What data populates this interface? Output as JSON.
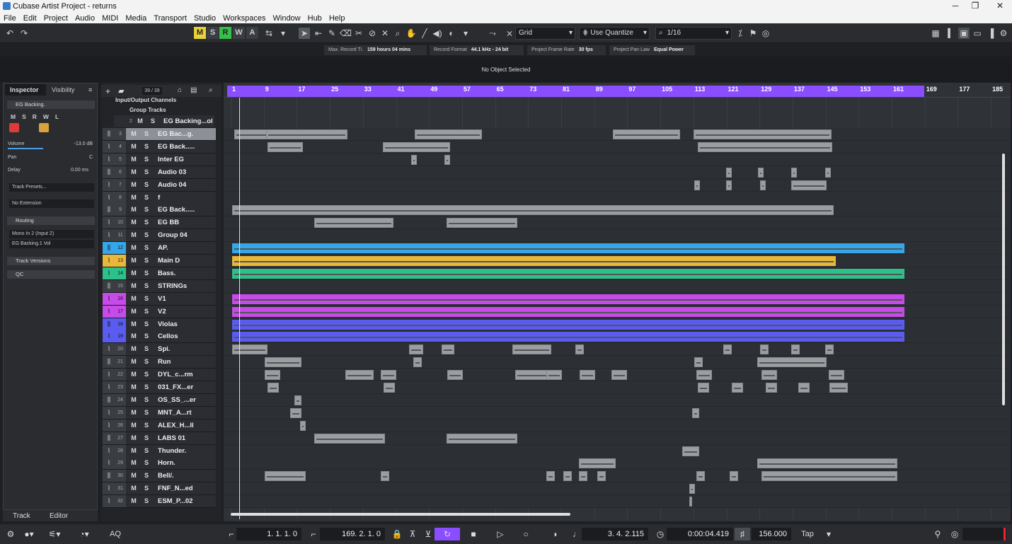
{
  "window": {
    "title": "Cubase Artist Project - returns",
    "min": "─",
    "max": "❐",
    "close": "✕"
  },
  "menu": [
    "File",
    "Edit",
    "Project",
    "Audio",
    "MIDI",
    "Media",
    "Transport",
    "Studio",
    "Workspaces",
    "Window",
    "Hub",
    "Help"
  ],
  "toolbar": {
    "undo": "↶",
    "redo": "↷",
    "m": "M",
    "s": "S",
    "r": "R",
    "w": "W",
    "a": "A",
    "grid_label": "Grid",
    "quantize_label": "Use Quantize",
    "quantize_value": "1/16"
  },
  "info": {
    "max_record_label": "Max. Record Ti.",
    "max_record_value": "159 hours 04 mins",
    "format_label": "Record Format",
    "format_value": "44.1 kHz - 24 bit",
    "frame_label": "Project Frame Rate",
    "frame_value": "30 fps",
    "pan_label": "Project Pan Law",
    "pan_value": "Equal Power"
  },
  "status": "No Object Selected",
  "inspector": {
    "tab1": "Inspector",
    "tab2": "Visibility",
    "track_name": "EG Backing.",
    "volume_label": "Volume",
    "volume_value": "-13.0 dB",
    "pan_label": "Pan",
    "pan_value": "C",
    "delay_label": "Delay",
    "delay_value": "0.00 ms",
    "presets": "Track Presets...",
    "extension": "No Extension",
    "routing": "Routing",
    "input": "Mono In 2 (Input 2)",
    "output": "EG Backing.1 Vol",
    "versions": "Track Versions",
    "qc": "QC",
    "tab_track": "Track",
    "tab_editor": "Editor",
    "btn_m": "M",
    "btn_s": "S",
    "btn_r": "R",
    "btn_w": "W",
    "btn_l": "L"
  },
  "tracklist": {
    "count": "39 / 39",
    "folders": [
      {
        "name": "Input/Output Channels"
      },
      {
        "name": "Group Tracks"
      }
    ],
    "group_row": {
      "num": "2",
      "name": "EG Backing...ol"
    },
    "m": "M",
    "s": "S",
    "tracks": [
      {
        "num": "3",
        "name": "EG Bac...g.",
        "color": "#9b9ea3"
      },
      {
        "num": "4",
        "name": "EG Back.....",
        "color": "#9b9ea3"
      },
      {
        "num": "5",
        "name": "Inter EG",
        "color": "#9b9ea3"
      },
      {
        "num": "6",
        "name": "Audio 03",
        "color": "#9b9ea3"
      },
      {
        "num": "7",
        "name": "Audio 04",
        "color": "#9b9ea3"
      },
      {
        "num": "8",
        "name": "f",
        "color": "#9b9ea3"
      },
      {
        "num": "9",
        "name": "EG Back.....",
        "color": "#9b9ea3"
      },
      {
        "num": "10",
        "name": "EG BB",
        "color": "#9b9ea3"
      },
      {
        "num": "11",
        "name": "Group 04",
        "color": "#9b9ea3"
      },
      {
        "num": "12",
        "name": "AP.",
        "color": "#35a6e8"
      },
      {
        "num": "13",
        "name": "Main D",
        "color": "#e8b83a"
      },
      {
        "num": "14",
        "name": "Bass.",
        "color": "#2cc08a"
      },
      {
        "num": "15",
        "name": "STRINGs",
        "color": "#9b9ea3"
      },
      {
        "num": "16",
        "name": "V1",
        "color": "#c64be8"
      },
      {
        "num": "17",
        "name": "V2",
        "color": "#c64be8"
      },
      {
        "num": "18",
        "name": "Violas",
        "color": "#5a5cf0"
      },
      {
        "num": "19",
        "name": "Cellos",
        "color": "#5a5cf0"
      },
      {
        "num": "20",
        "name": "Spi.",
        "color": "#9b9ea3"
      },
      {
        "num": "21",
        "name": "Run",
        "color": "#9b9ea3"
      },
      {
        "num": "22",
        "name": "DYL_c...rm",
        "color": "#9b9ea3"
      },
      {
        "num": "23",
        "name": "031_FX...er",
        "color": "#9b9ea3"
      },
      {
        "num": "24",
        "name": "OS_SS_...er",
        "color": "#9b9ea3"
      },
      {
        "num": "25",
        "name": "MNT_A...rt",
        "color": "#9b9ea3"
      },
      {
        "num": "26",
        "name": "ALEX_H...ll",
        "color": "#9b9ea3"
      },
      {
        "num": "27",
        "name": "LABS 01",
        "color": "#9b9ea3"
      },
      {
        "num": "28",
        "name": "Thunder.",
        "color": "#9b9ea3"
      },
      {
        "num": "29",
        "name": "Horn.",
        "color": "#9b9ea3"
      },
      {
        "num": "30",
        "name": "Bell/.",
        "color": "#9b9ea3"
      },
      {
        "num": "31",
        "name": "FNF_N...ed",
        "color": "#9b9ea3"
      },
      {
        "num": "32",
        "name": "ESM_P...02",
        "color": "#9b9ea3"
      }
    ]
  },
  "ruler": [
    "1",
    "9",
    "17",
    "25",
    "33",
    "41",
    "49",
    "57",
    "65",
    "73",
    "81",
    "89",
    "97",
    "105",
    "113",
    "121",
    "129",
    "137",
    "145",
    "153",
    "161",
    "169",
    "177",
    "185"
  ],
  "transport": {
    "left_locator": "1. 1. 1. 0",
    "right_locator": "169. 2. 1. 0",
    "position": "3. 4. 2.115",
    "time": "0:00:04.419",
    "tempo": "156.000",
    "tap": "Tap",
    "aq": "AQ"
  }
}
